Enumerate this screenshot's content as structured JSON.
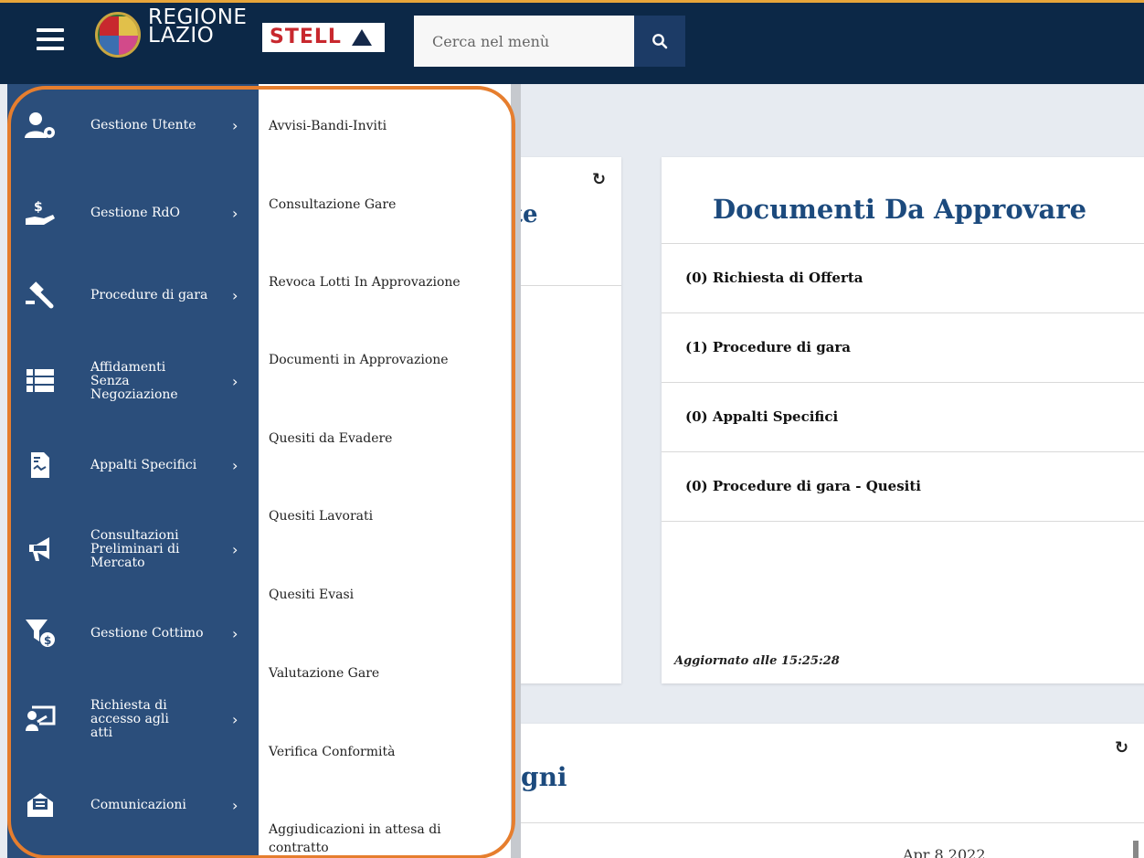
{
  "header": {
    "logo_line1": "REGIONE",
    "logo_line2": "LAZIO",
    "brand": "STELL",
    "search_placeholder": "Cerca nel menù",
    "accent_color": "#e8a53a",
    "bg_color": "#0c2847"
  },
  "sidebar": {
    "items": [
      {
        "label": "Gestione Utente",
        "icon": "user-gear-icon"
      },
      {
        "label": "Gestione RdO",
        "icon": "hand-dollar-icon"
      },
      {
        "label": "Procedure di gara",
        "icon": "gavel-icon"
      },
      {
        "label": "Affidamenti Senza Negoziazione",
        "icon": "list-icon"
      },
      {
        "label": "Appalti Specifici",
        "icon": "document-icon"
      },
      {
        "label": "Consultazioni Preliminari di Mercato",
        "icon": "megaphone-icon"
      },
      {
        "label": "Gestione Cottimo",
        "icon": "filter-dollar-icon"
      },
      {
        "label": "Richiesta di accesso agli atti",
        "icon": "presentation-icon"
      },
      {
        "label": "Comunicazioni",
        "icon": "envelope-icon"
      }
    ]
  },
  "submenu": {
    "items": [
      "Avvisi-Bandi-Inviti",
      "Consultazione Gare",
      "Revoca Lotti In Approvazione",
      "Documenti in Approvazione",
      "Quesiti da Evadere",
      "Quesiti Lavorati",
      "Quesiti Evasi",
      "Valutazione Gare",
      "Verifica Conformità",
      "Aggiudicazioni in attesa di contratto"
    ]
  },
  "cards": {
    "left_partial_title": "te",
    "right": {
      "title": "Documenti Da Approvare",
      "rows": [
        "(0) Richiesta di Offerta",
        "(1) Procedure di gara",
        "(0) Appalti Specifici",
        "(0) Procedure di gara - Quesiti"
      ],
      "updated": "Aggiornato alle 15:25:28"
    },
    "bottom": {
      "partial_title": "gni",
      "date": "Apr 8 2022"
    }
  }
}
